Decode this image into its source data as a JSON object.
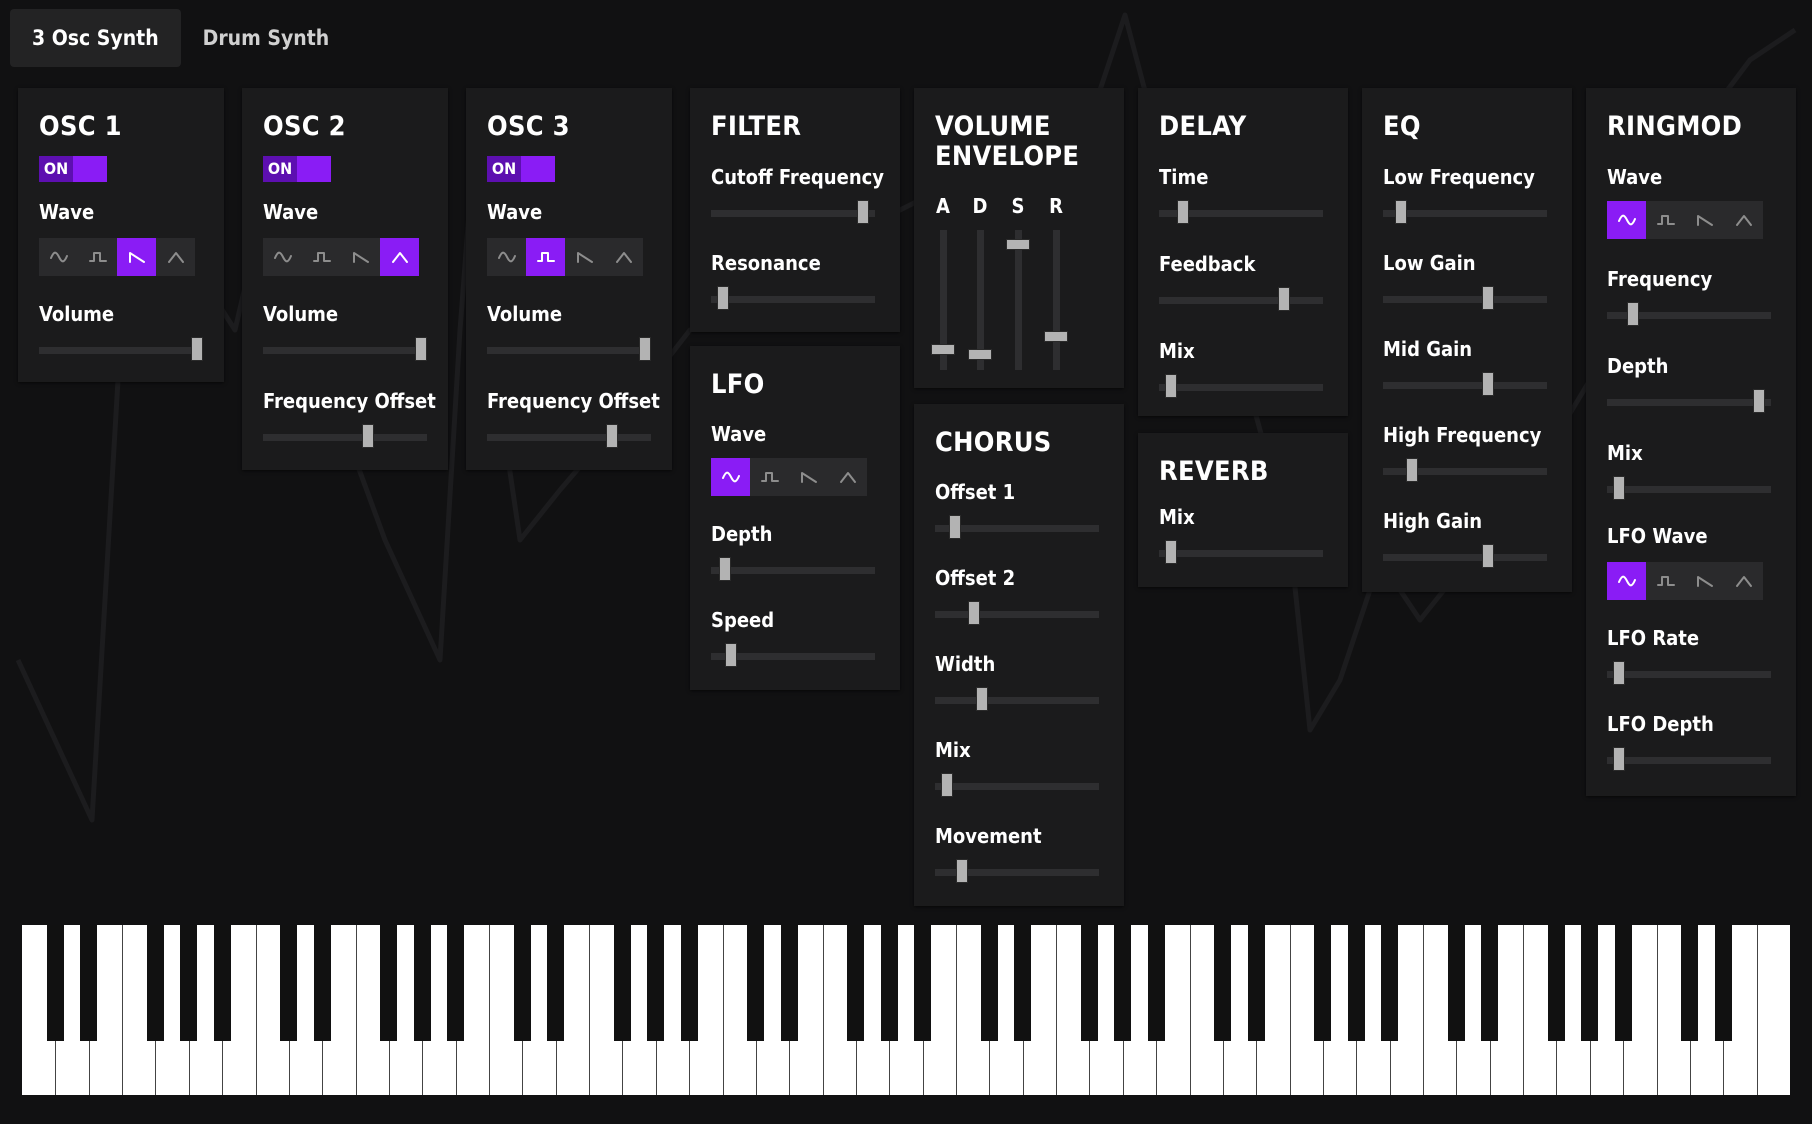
{
  "tabs": [
    {
      "label": "3 Osc Synth",
      "active": true
    },
    {
      "label": "Drum Synth",
      "active": false
    }
  ],
  "colors": {
    "accent": "#8a1cf5",
    "toggle_knob": "#5d0fb0",
    "panel": "#1b1b1c",
    "background": "#111112",
    "track": "#2e2e30",
    "thumb": "#b3b3b3"
  },
  "wave_icons": [
    "sine-wave-icon",
    "square-wave-icon",
    "sawtooth-wave-icon",
    "triangle-wave-icon"
  ],
  "panels": [
    {
      "id": "osc1",
      "title": "OSC 1",
      "toggle": "ON",
      "wave_label": "Wave",
      "wave_selected": 2,
      "sliders": [
        {
          "label": "Volume",
          "value": 1.0
        }
      ]
    },
    {
      "id": "osc2",
      "title": "OSC 2",
      "toggle": "ON",
      "wave_label": "Wave",
      "wave_selected": 3,
      "sliders": [
        {
          "label": "Volume",
          "value": 1.0
        },
        {
          "label": "Frequency Offset",
          "value": 0.65
        }
      ]
    },
    {
      "id": "osc3",
      "title": "OSC 3",
      "toggle": "ON",
      "wave_label": "Wave",
      "wave_selected": 1,
      "sliders": [
        {
          "label": "Volume",
          "value": 1.0
        },
        {
          "label": "Frequency Offset",
          "value": 0.78
        }
      ]
    },
    {
      "id": "filter",
      "title": "FILTER",
      "sliders": [
        {
          "label": "Cutoff Frequency",
          "value": 0.96
        },
        {
          "label": "Resonance",
          "value": 0.04
        }
      ]
    },
    {
      "id": "lfo",
      "title": "LFO",
      "wave_label": "Wave",
      "wave_selected": 0,
      "sliders": [
        {
          "label": "Depth",
          "value": 0.05
        },
        {
          "label": "Speed",
          "value": 0.09
        }
      ]
    },
    {
      "id": "envelope",
      "title_lines": [
        "VOLUME",
        "ENVELOPE"
      ],
      "adsr": [
        {
          "label": "A",
          "value": 0.1
        },
        {
          "label": "D",
          "value": 0.06
        },
        {
          "label": "S",
          "value": 0.94
        },
        {
          "label": "R",
          "value": 0.2
        }
      ]
    },
    {
      "id": "chorus",
      "title": "CHORUS",
      "sliders": [
        {
          "label": "Offset 1",
          "value": 0.09
        },
        {
          "label": "Offset 2",
          "value": 0.22
        },
        {
          "label": "Width",
          "value": 0.27
        },
        {
          "label": "Mix",
          "value": 0.04
        },
        {
          "label": "Movement",
          "value": 0.14
        }
      ]
    },
    {
      "id": "delay",
      "title": "DELAY",
      "sliders": [
        {
          "label": "Time",
          "value": 0.12
        },
        {
          "label": "Feedback",
          "value": 0.78
        },
        {
          "label": "Mix",
          "value": 0.04
        }
      ]
    },
    {
      "id": "reverb",
      "title": "REVERB",
      "sliders": [
        {
          "label": "Mix",
          "value": 0.04
        }
      ]
    },
    {
      "id": "eq",
      "title": "EQ",
      "sliders": [
        {
          "label": "Low Frequency",
          "value": 0.08
        },
        {
          "label": "Low Gain",
          "value": 0.65
        },
        {
          "label": "Mid Gain",
          "value": 0.65
        },
        {
          "label": "High Frequency",
          "value": 0.15
        },
        {
          "label": "High Gain",
          "value": 0.65
        }
      ]
    },
    {
      "id": "ringmod",
      "title": "RINGMOD",
      "wave_label": "Wave",
      "wave_selected": 0,
      "sliders": [
        {
          "label": "Frequency",
          "value": 0.13
        },
        {
          "label": "Depth",
          "value": 0.96
        },
        {
          "label": "Mix",
          "value": 0.04
        }
      ],
      "lfo_wave_label": "LFO Wave",
      "lfo_wave_selected": 0,
      "lfo_sliders": [
        {
          "label": "LFO Rate",
          "value": 0.04
        },
        {
          "label": "LFO Depth",
          "value": 0.04
        }
      ]
    }
  ],
  "keyboard": {
    "white_keys": 53
  }
}
